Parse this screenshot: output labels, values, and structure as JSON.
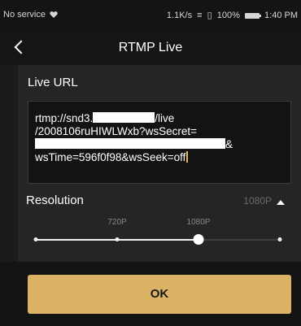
{
  "status_bar": {
    "carrier": "No service",
    "network_speed": "1.1K/s",
    "signal": "≡",
    "vibrate": "▯",
    "battery": "100%",
    "time": "1:40 PM"
  },
  "header": {
    "title": "RTMP Live"
  },
  "live_url": {
    "label": "Live URL",
    "line1_pre": "rtmp://snd3.",
    "line1_post": "/live",
    "line2": "/2008106ruHIWLWxb?wsSecret=",
    "line3_post": "&",
    "line4": "wsTime=596f0f98&wsSeek=off"
  },
  "resolution": {
    "label": "Resolution",
    "current_value": "1080P",
    "options": [
      "",
      "720P",
      "1080P",
      ""
    ],
    "selected_index": 2
  },
  "ok_button": {
    "label": "OK"
  },
  "colors": {
    "accent": "#dcb265",
    "background": "#1b1b1b",
    "panel": "#252525"
  }
}
